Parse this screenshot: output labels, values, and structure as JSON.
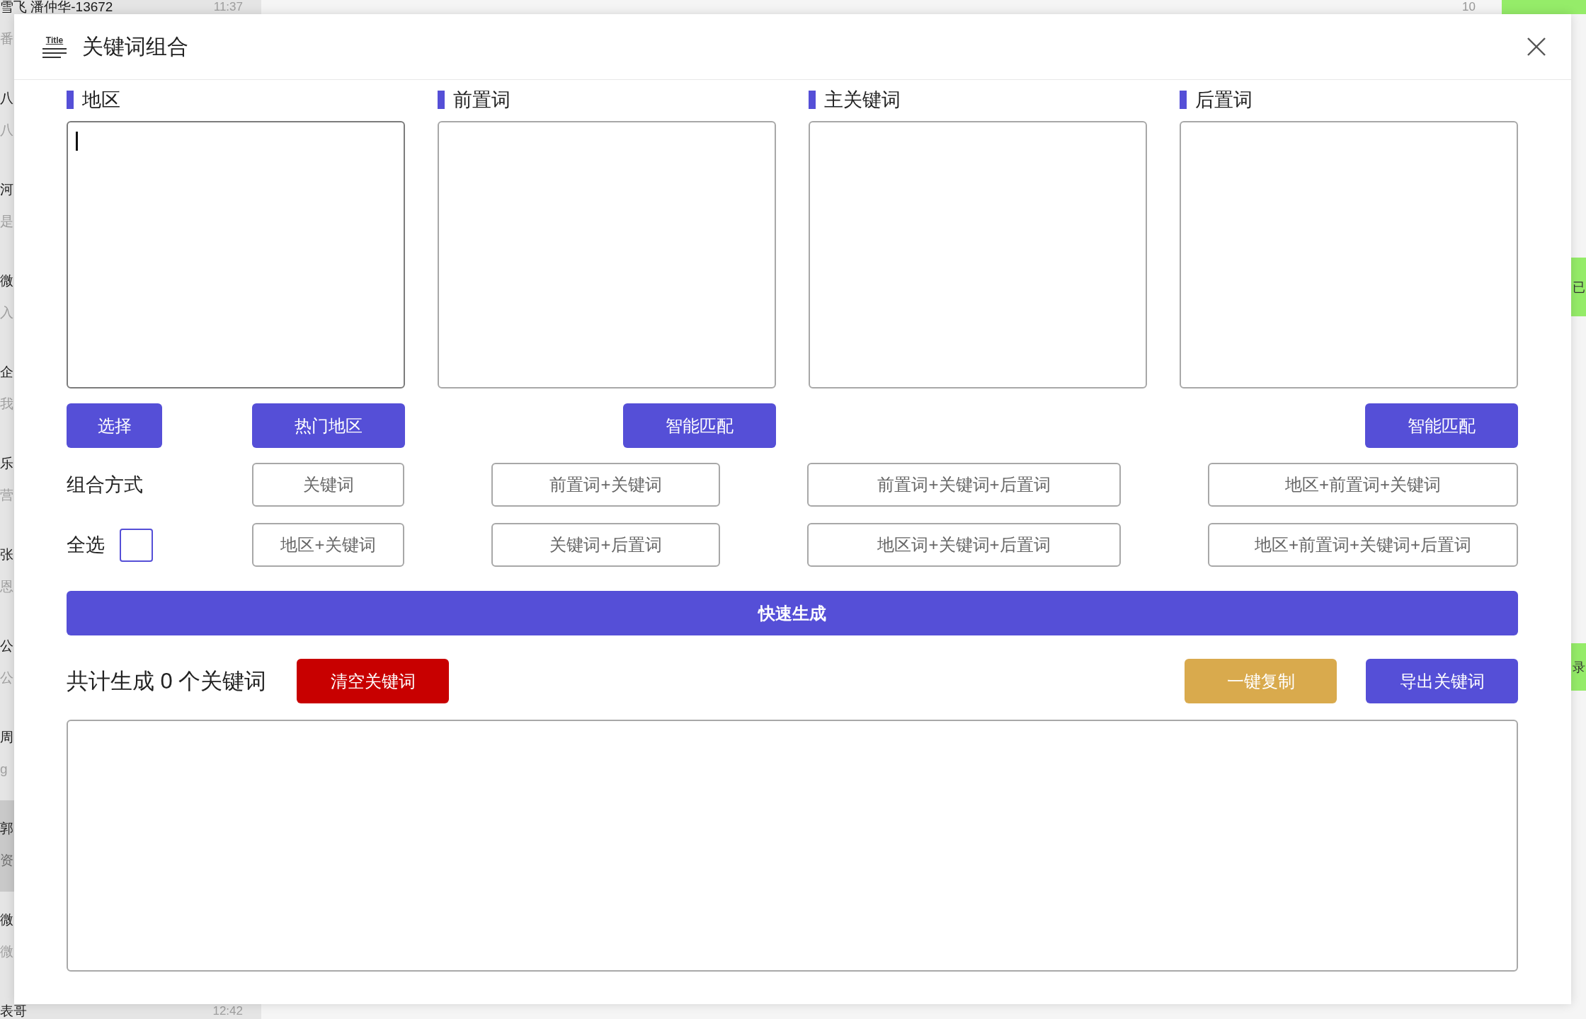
{
  "chat_list": [
    {
      "name": "雪飞  潘仲华-13672",
      "time": "11:37",
      "preview": "番",
      "selected": false
    },
    {
      "name": "八",
      "preview": "八",
      "selected": false
    },
    {
      "name": "河",
      "preview": "是",
      "selected": false
    },
    {
      "name": "微",
      "preview": "入",
      "selected": false
    },
    {
      "name": "企",
      "preview": "我",
      "selected": false
    },
    {
      "name": "乐",
      "preview": "营",
      "selected": false
    },
    {
      "name": "张",
      "preview": "恩",
      "selected": false
    },
    {
      "name": "公",
      "preview": "公",
      "selected": false
    },
    {
      "name": "周",
      "preview": "g",
      "selected": false
    },
    {
      "name": "郭",
      "preview": "资",
      "selected": true
    },
    {
      "name": "微",
      "preview": "微",
      "selected": false
    },
    {
      "name": "表哥",
      "time": "12:42",
      "selected": false
    }
  ],
  "chat_header": {
    "time": "10"
  },
  "side_tabs": [
    {
      "label": "已"
    },
    {
      "label": "录"
    }
  ],
  "dialog": {
    "icon_label": "Title",
    "title": "关键词组合",
    "columns": [
      {
        "label": "地区",
        "focused": true,
        "buttons": [
          "选择",
          "热门地区"
        ]
      },
      {
        "label": "前置词",
        "focused": false,
        "buttons": [
          "智能匹配"
        ]
      },
      {
        "label": "主关键词",
        "focused": false
      },
      {
        "label": "后置词",
        "focused": false,
        "buttons": [
          "智能匹配"
        ]
      }
    ],
    "combination": {
      "label": "组合方式",
      "select_all": {
        "label": "全选",
        "checked": false
      },
      "options": [
        {
          "label": "关键词",
          "selected": false
        },
        {
          "label": "前置词+关键词",
          "selected": false
        },
        {
          "label": "前置词+关键词+后置词",
          "selected": false
        },
        {
          "label": "地区+前置词+关键词",
          "selected": false
        },
        {
          "label": "地区+关键词",
          "selected": false
        },
        {
          "label": "关键词+后置词",
          "selected": false
        },
        {
          "label": "地区词+关键词+后置词",
          "selected": false
        },
        {
          "label": "地区+前置词+关键词+后置词",
          "selected": false
        }
      ]
    },
    "generate_button": "快速生成",
    "summary": "共计生成 0 个关键词",
    "result_buttons": [
      {
        "label": "清空关键词",
        "kind": "danger"
      },
      {
        "label": "一键复制",
        "kind": "warning"
      },
      {
        "label": "导出关键词",
        "kind": "primary"
      }
    ]
  }
}
